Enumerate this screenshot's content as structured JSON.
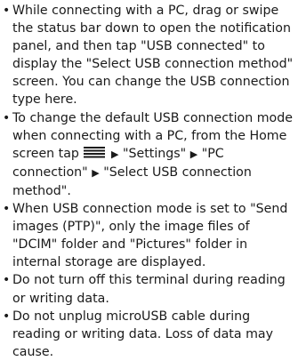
{
  "bullet_glyph": "•",
  "arrow_glyph": "▶",
  "notes": [
    {
      "text": "While connecting with a PC, drag or swipe the status bar down to open the notification panel, and then tap \"USB connected\" to display the \"Select USB connection method\" screen. You can change the USB connection type here."
    },
    {
      "text_before_icon": "To change the default USB connection mode when connecting with a PC, from the Home screen tap",
      "icon": "menu-icon",
      "step_1": "\"Settings\"",
      "step_2": "\"PC connection\"",
      "step_3": "\"Select USB connection method\"."
    },
    {
      "text": "When USB connection mode is set to \"Send images (PTP)\", only the image files of \"DCIM\" folder and \"Pictures\" folder in internal storage are displayed."
    },
    {
      "text": "Do not turn off this terminal during reading or writing data."
    },
    {
      "text": "Do not unplug microUSB cable during reading or writing data. Loss of data may cause."
    }
  ]
}
